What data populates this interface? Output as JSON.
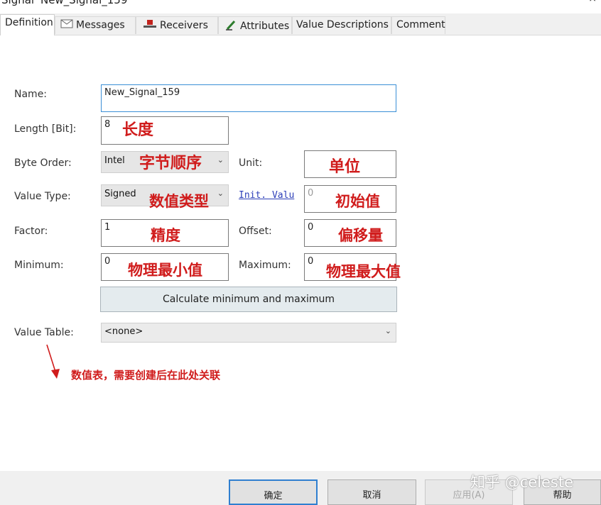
{
  "window": {
    "title": "Signal 'New_Signal_159'",
    "close_glyph": "×"
  },
  "tabs": [
    {
      "label": "Definition",
      "active": true
    },
    {
      "label": "Messages",
      "icon": "envelope-icon"
    },
    {
      "label": "Receivers",
      "icon": "ecu-icon"
    },
    {
      "label": "Attributes",
      "icon": "attribute-pen-icon"
    },
    {
      "label": "Value Descriptions"
    },
    {
      "label": "Comment"
    }
  ],
  "form": {
    "name": {
      "label": "Name:",
      "value": "New_Signal_159"
    },
    "length": {
      "label": "Length [Bit]:",
      "value": "8"
    },
    "byte_order": {
      "label": "Byte Order:",
      "value": "Intel"
    },
    "unit": {
      "label": "Unit:",
      "value": ""
    },
    "value_type": {
      "label": "Value Type:",
      "value": "Signed"
    },
    "init_value": {
      "label": "Init. Valu",
      "value": "0"
    },
    "factor": {
      "label": "Factor:",
      "value": "1"
    },
    "offset": {
      "label": "Offset:",
      "value": "0"
    },
    "minimum": {
      "label": "Minimum:",
      "value": "0"
    },
    "maximum": {
      "label": "Maximum:",
      "value": "0"
    },
    "calc_button": "Calculate minimum and maximum",
    "value_table": {
      "label": "Value Table:",
      "value": "<none>"
    }
  },
  "annotations": {
    "length": "长度",
    "byte_order": "字节顺序",
    "unit": "单位",
    "value_type": "数值类型",
    "init_value": "初始值",
    "factor": "精度",
    "offset": "偏移量",
    "minimum": "物理最小值",
    "maximum": "物理最大值",
    "value_table": "数值表，需要创建后在此处关联"
  },
  "footer": {
    "ok": "确定",
    "cancel": "取消",
    "apply": "应用(A)",
    "help": "帮助"
  },
  "watermark": "知乎 @celeste",
  "colors": {
    "annotation": "#d01c1c",
    "link": "#2c3eb8",
    "focus": "#3b8fd6"
  }
}
